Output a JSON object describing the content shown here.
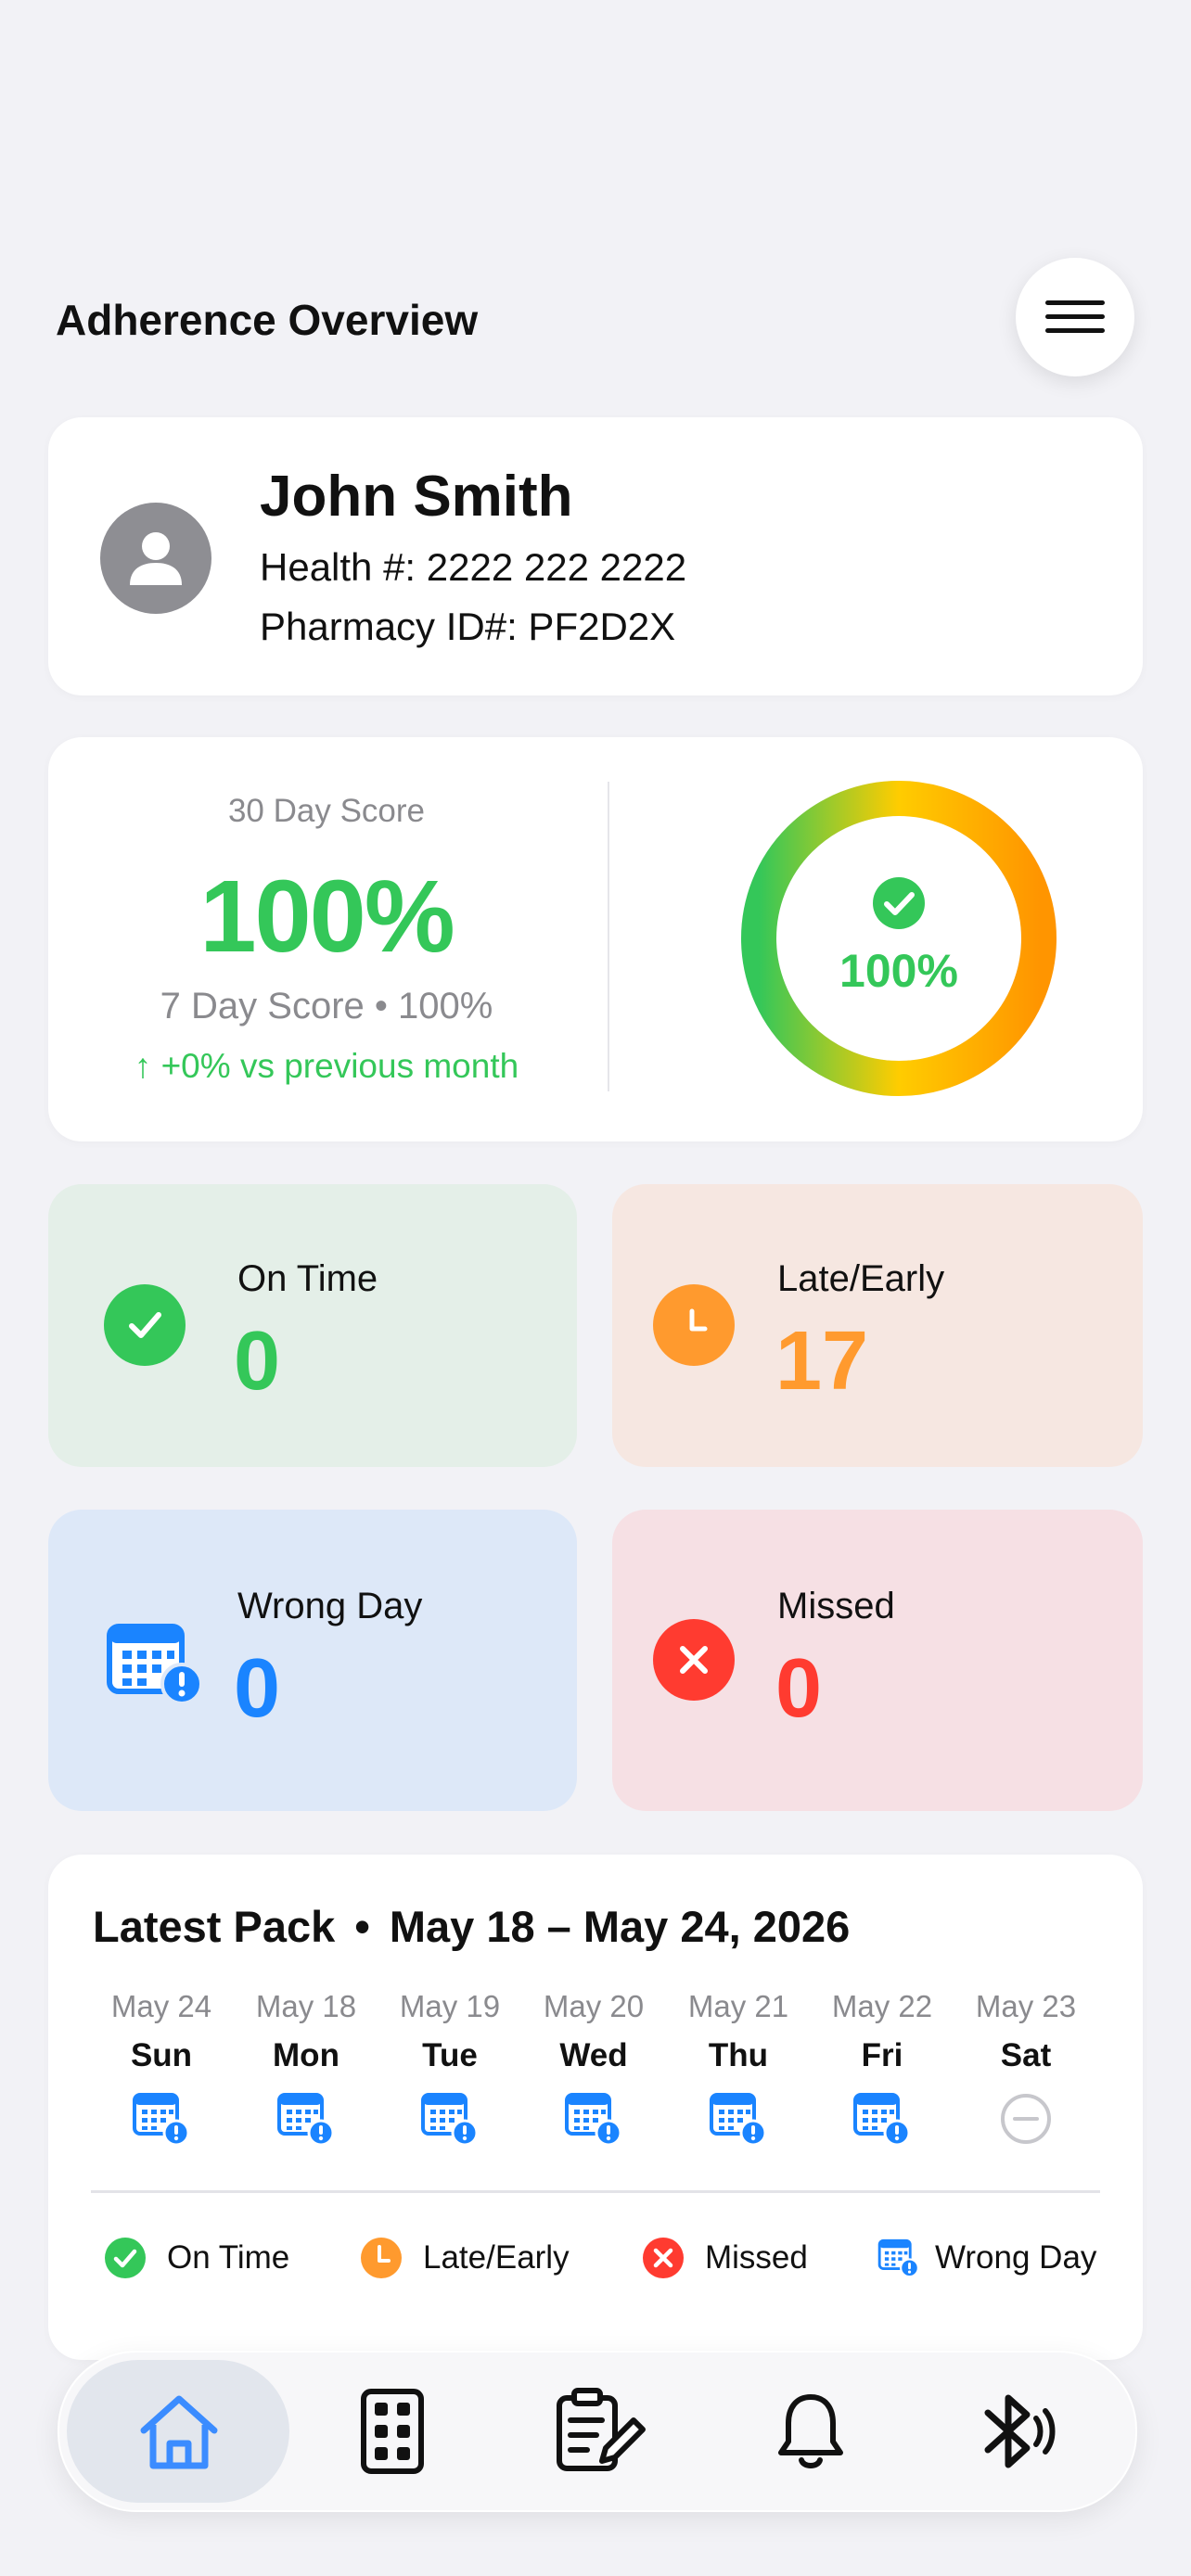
{
  "header": {
    "title": "Adherence Overview",
    "menu_icon": "hamburger-menu-icon"
  },
  "profile": {
    "name": "John Smith",
    "health_number": "Health #: 2222 222 2222",
    "pharmacy_id": "Pharmacy ID#: PF2D2X",
    "avatar_icon": "person-icon"
  },
  "score": {
    "label_30": "30 Day Score",
    "value_30": "100%",
    "week_line": "7 Day Score • 100%",
    "trend": "↑ +0% vs previous month",
    "ring_value": "100%",
    "ring_fraction": 1.0,
    "colors": {
      "good": "#34c759",
      "mid": "#ffcc00",
      "warn": "#ff9500"
    }
  },
  "stats": {
    "on_time": {
      "label": "On Time",
      "value": "0",
      "color": "#34c759",
      "icon": "checkmark-circle-icon"
    },
    "late_early": {
      "label": "Late/Early",
      "value": "17",
      "color": "#ff9a2e",
      "icon": "clock-icon"
    },
    "wrong_day": {
      "label": "Wrong Day",
      "value": "0",
      "color": "#1a84ff",
      "icon": "calendar-alert-icon"
    },
    "missed": {
      "label": "Missed",
      "value": "0",
      "color": "#ff3b30",
      "icon": "x-circle-icon"
    }
  },
  "pack": {
    "title_prefix": "Latest Pack",
    "bullet": "•",
    "range": "May 18 – May 24, 2026",
    "days": [
      {
        "date": "May 24",
        "day": "Sun",
        "status": "wrong-day"
      },
      {
        "date": "May 18",
        "day": "Mon",
        "status": "wrong-day"
      },
      {
        "date": "May 19",
        "day": "Tue",
        "status": "wrong-day"
      },
      {
        "date": "May 20",
        "day": "Wed",
        "status": "wrong-day"
      },
      {
        "date": "May 21",
        "day": "Thu",
        "status": "wrong-day"
      },
      {
        "date": "May 22",
        "day": "Fri",
        "status": "wrong-day"
      },
      {
        "date": "May 23",
        "day": "Sat",
        "status": "none"
      }
    ],
    "legend": [
      "On Time",
      "Late/Early",
      "Missed",
      "Wrong Day"
    ]
  },
  "tabbar": {
    "items": [
      "home-icon",
      "pill-pack-icon",
      "checklist-edit-icon",
      "bell-icon",
      "bluetooth-icon"
    ],
    "active": "home-icon",
    "active_color": "#3b8cff"
  }
}
